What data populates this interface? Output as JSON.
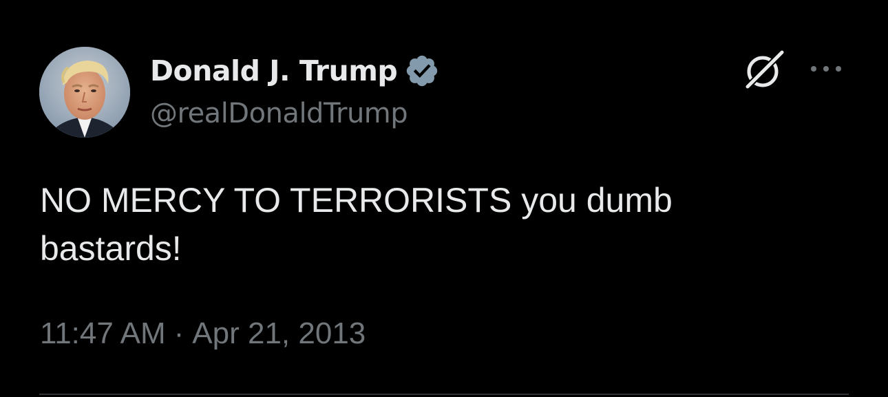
{
  "author": {
    "display_name": "Donald J. Trump",
    "handle": "@realDonaldTrump",
    "verified": true,
    "verified_badge_color": "#829aab",
    "avatar_icon": "profile-photo"
  },
  "actions": {
    "grok_icon": "grok-icon",
    "more_icon": "more-horizontal-icon"
  },
  "tweet": {
    "text_line_1": "NO MERCY TO TERRORISTS you dumb",
    "text_line_2": "bastards!"
  },
  "meta": {
    "time": "11:47 AM",
    "separator": "·",
    "date": "Apr 21, 2013"
  },
  "colors": {
    "background": "#000000",
    "primary_text": "#e7e9ea",
    "secondary_text": "#71767b",
    "divider": "#2f3336"
  }
}
